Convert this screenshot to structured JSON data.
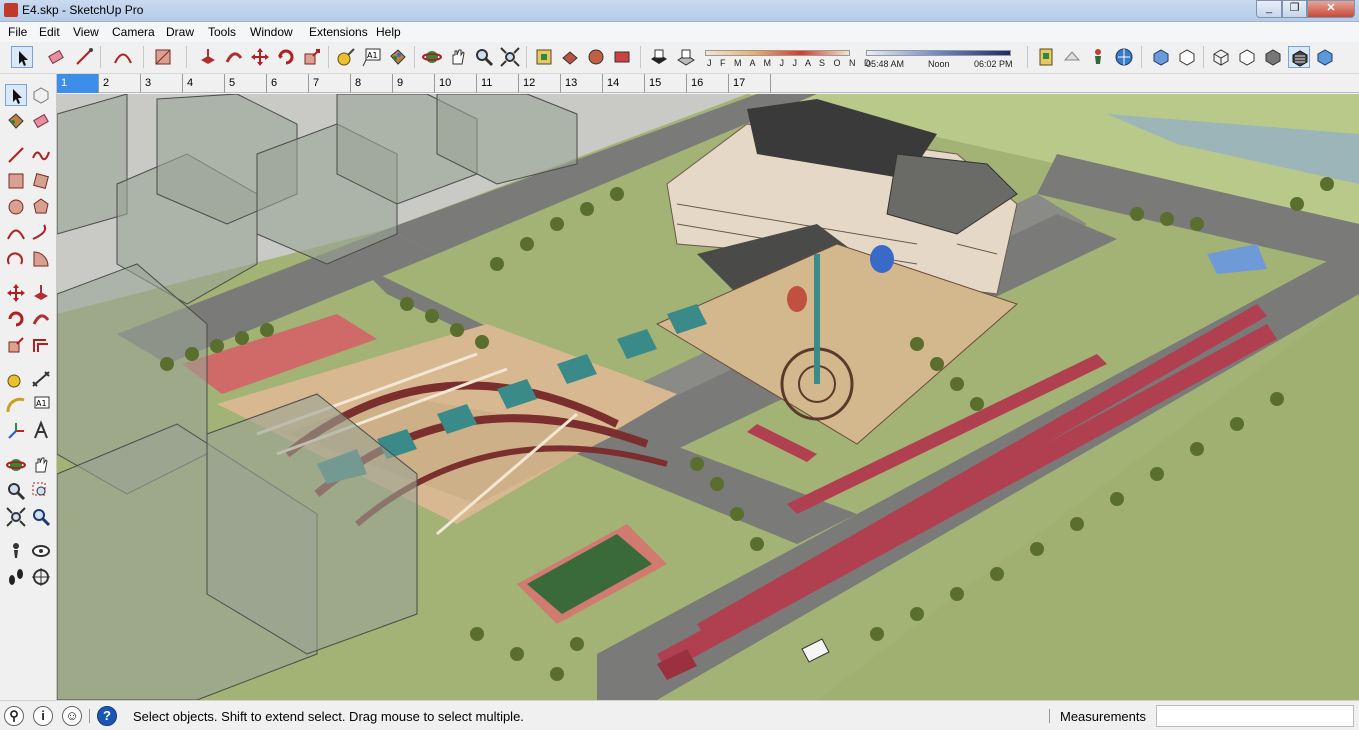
{
  "window": {
    "title": "E4.skp - SketchUp Pro",
    "controls": [
      "_",
      "❐",
      "✕"
    ]
  },
  "menu": [
    "File",
    "Edit",
    "View",
    "Camera",
    "Draw",
    "Tools",
    "Window",
    "Extensions",
    "Help"
  ],
  "toolbar": {
    "shadow_months": "J F M A M J J A S O N D",
    "time_start": "05:48 AM",
    "time_noon": "Noon",
    "time_end": "06:02 PM"
  },
  "scenes": [
    "1",
    "2",
    "3",
    "4",
    "5",
    "6",
    "7",
    "8",
    "9",
    "10",
    "11",
    "12",
    "13",
    "14",
    "15",
    "16",
    "17"
  ],
  "active_scene": "1",
  "status": {
    "message": "Select objects. Shift to extend select. Drag mouse to select multiple.",
    "measurements_label": "Measurements",
    "measurements_value": ""
  },
  "colors": {
    "accent": "#3d8ee8",
    "ground": "#a0b070",
    "road": "#7a7a78",
    "plaza": "#d8b890",
    "parking": "#b04050",
    "tree": "#5a6e2e",
    "building": "#e6d8c6",
    "glass": "#8a9a8a"
  }
}
